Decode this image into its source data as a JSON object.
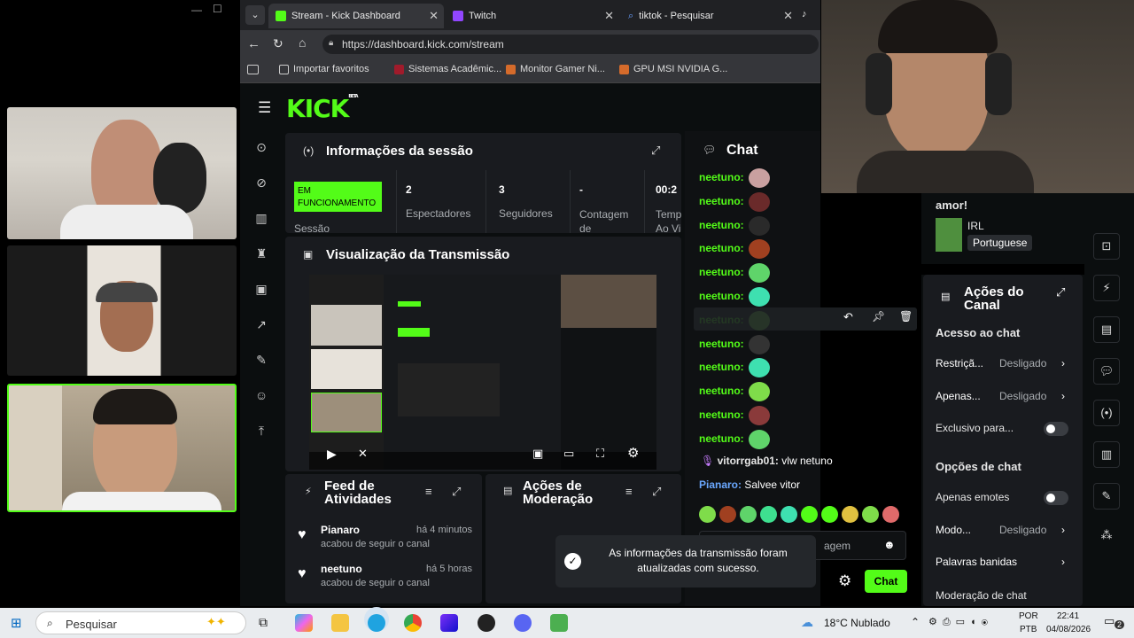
{
  "browser": {
    "tabs": [
      {
        "label": "Stream - Kick Dashboard"
      },
      {
        "label": "Twitch"
      },
      {
        "label": "tiktok - Pesquisar"
      }
    ],
    "url": "https://dashboard.kick.com/stream",
    "bookmarks": [
      "Importar favoritos",
      "Sistemas Acadêmic...",
      "Monitor Gamer Ni...",
      "GPU MSI NVIDIA G..."
    ]
  },
  "kick": {
    "logo": "KICK",
    "logo_badge": "BETA",
    "session": {
      "title": "Informações da sessão",
      "status": "EM FUNCIONAMENTO",
      "status_label": "Sessão",
      "stats": [
        {
          "value": "2",
          "label": "Espectadores"
        },
        {
          "value": "3",
          "label": "Seguidores"
        },
        {
          "value": "-",
          "label": "Contagem de"
        },
        {
          "value": "00:2",
          "label": "Temp Ao Vi"
        }
      ]
    },
    "preview": {
      "title": "Visualização da Transmissão"
    },
    "feed": {
      "title": "Feed de Atividades",
      "items": [
        {
          "user": "Pianaro",
          "time": "há 4 minutos",
          "action": "acabou de seguir o canal"
        },
        {
          "user": "neetuno",
          "time": "há 5 horas",
          "action": "acabou de seguir o canal"
        }
      ]
    },
    "moderation": {
      "title": "Ações de Moderação"
    },
    "toast": "As informações da transmissão foram atualizadas com sucesso."
  },
  "chat": {
    "title": "Chat",
    "messages": [
      {
        "user": "neetuno:",
        "emote_color": "#c9a0a0"
      },
      {
        "user": "neetuno:",
        "emote_color": "#6a2a2a"
      },
      {
        "user": "neetuno:",
        "emote_color": "#2a2a2a"
      },
      {
        "user": "neetuno:",
        "emote_color": "#a04020"
      },
      {
        "user": "neetuno:",
        "emote_color": "#5fd46a"
      },
      {
        "user": "neetuno:",
        "emote_color": "#3ee0b0"
      },
      {
        "user": "neetuno:",
        "emote_color": "#7fdc4a"
      },
      {
        "user": "neetuno:",
        "emote_color": "#333333"
      },
      {
        "user": "neetuno:",
        "emote_color": "#3ee0b0"
      },
      {
        "user": "neetuno:",
        "emote_color": "#7fdc4a"
      },
      {
        "user": "neetuno:",
        "emote_color": "#8a3a3a"
      },
      {
        "user": "neetuno:",
        "emote_color": "#5fd46a"
      }
    ],
    "msg1_user": "vitorrgab01:",
    "msg1_text": "vlw netuno",
    "msg2_user": "Pianaro:",
    "msg2_text": "Salvee vitor",
    "input_placeholder": "agem",
    "send_label": "Chat"
  },
  "right_panel": {
    "top_text": "amor!",
    "category": "IRL",
    "language": "Portuguese",
    "actions_title": "Ações do Canal",
    "access_heading": "Acesso ao chat",
    "rows": [
      {
        "label": "Restriçã...",
        "value": "Desligado"
      },
      {
        "label": "Apenas...",
        "value": "Desligado"
      }
    ],
    "exclusive": "Exclusivo para...",
    "options_heading": "Opções de chat",
    "emotes_only": "Apenas emotes",
    "mode": {
      "label": "Modo...",
      "value": "Desligado"
    },
    "banned": "Palavras banidas",
    "mod_chat": "Moderação de chat"
  },
  "taskbar": {
    "search": "Pesquisar",
    "weather": "18°C  Nublado",
    "lang1": "POR",
    "lang2": "PTB",
    "time": "22:41",
    "date": "04/08/2026",
    "notif": "2"
  },
  "colors": {
    "kick_green": "#53fc18",
    "bg": "#0b0e0f",
    "card": "#191b1f"
  }
}
